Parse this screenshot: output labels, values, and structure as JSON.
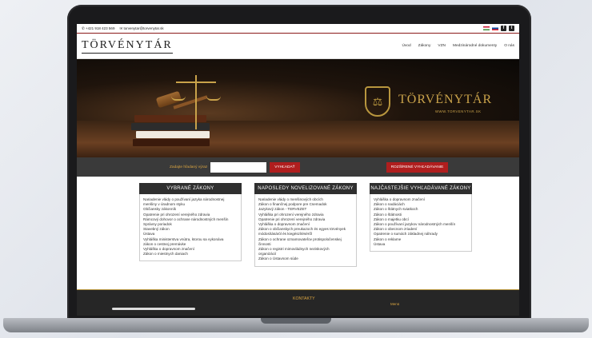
{
  "topbar": {
    "phone": "+421 918 423 569",
    "email": "torvenytar@torvenytar.sk"
  },
  "logo": "TÖRVÉNYTÁR",
  "nav": [
    "Úvod",
    "Zákony",
    "VZN",
    "Medzinárodné dokumenty",
    "O nás"
  ],
  "hero": {
    "brand": "TÖRVÉNYTÁR",
    "brand_sub": "WWW.TORVENYTAR.SK"
  },
  "search": {
    "label": "Zadajte hľadaný výraz",
    "button": "VYHĽADAŤ",
    "advanced": "ROZŠÍRENÉ VYHĽADÁVANIE"
  },
  "boxes": [
    {
      "title": "VYBRANÉ ZÁKONY",
      "items": [
        "Nariadenie vlády o používaní jazyka národnostnej",
        "menšiny v úradnom styku",
        "Občiansky zákonník",
        "Opatrenie pri ohrození verejného zdravia",
        "Rámcový dohovor o ochrane národnostných menšín",
        "Správny poriadok",
        "Stavebný zákon",
        "Ústava",
        "Vyhláška ministerstva vnútra, ktorou sa vykonáva",
        "zákon o cestnej premávke",
        "Vyhláška o dopravnom značení",
        "Zákon o miestnych daniach"
      ]
    },
    {
      "title": "NAPOSLEDY NOVELIZOVANÉ ZÁKONY",
      "items": [
        "Nariadenie vlády o menšinových obcích",
        "Zákon o finančnej podpore pre Csemadok",
        "Jazykový zákon - TERVEZET",
        "Vyhláška pri ohrození verejného zdravia",
        "Opatrenie pri ohrození verejného zdravia",
        "Vyhláška o dopravnom značení",
        "Zákon o občianskych preukazoch és egyes törvények",
        "módosításáról és kiegészítéséről",
        "Zákon o ochrane oznamovateľov protispoločenskej",
        "činnosti",
        "Zákon o registri mimovládnych neziskových",
        "organizácií",
        "Zákon o Ústavnom súde"
      ]
    },
    {
      "title": "NAJČASTEJŠIE VYHĽADÁVANÉ ZÁKONY",
      "items": [
        "Vyhláška o dopravnom značení",
        "Zákon o nadáciách",
        "Zákon o štátnych sviatkoch",
        "Zákon o štátnosti",
        "Zákon o majetku obcí",
        "Zákon o používaní jazykov národnostných menšín",
        "Zákon o obecnom zriadení",
        "Opatrenie o sumách základnej náhrady",
        "Zákon o reklame",
        "Ústava"
      ]
    }
  ],
  "footer": {
    "title": "KONTAKTY",
    "menu": "Menü"
  }
}
